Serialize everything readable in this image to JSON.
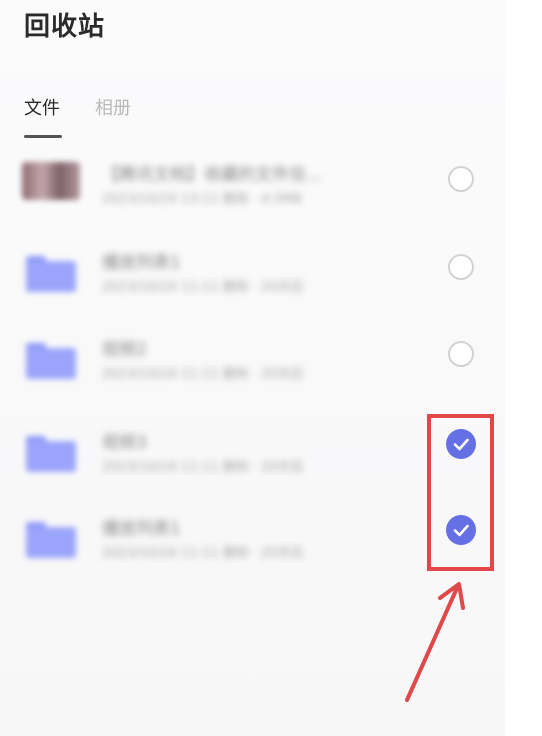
{
  "page": {
    "title": "回收站"
  },
  "tabs": [
    {
      "label": "文件",
      "active": true
    },
    {
      "label": "相册",
      "active": false
    }
  ],
  "items": [
    {
      "icon": "image-thumbnail-icon",
      "name": "【腾讯文档】收藏的文件信...",
      "meta": "2023/10/24 13:11 删除 · 4.5MB",
      "checked": false
    },
    {
      "icon": "folder-icon",
      "name": "播放列表1",
      "meta": "2023/10/24 11:11 删除 · 20天后",
      "checked": false
    },
    {
      "icon": "folder-icon",
      "name": "视频2",
      "meta": "2023/10/24 11:11 删除 · 20天后",
      "checked": false
    },
    {
      "icon": "folder-icon",
      "name": "视频3",
      "meta": "2023/10/24 11:11 删除 · 20天后",
      "checked": true
    },
    {
      "icon": "folder-icon",
      "name": "播放列表1",
      "meta": "2023/10/24 11:11 删除 · 20天后",
      "checked": true
    }
  ],
  "colors": {
    "accent": "#6470e4",
    "folder": "#9aa4fa",
    "annotation": "#e04849"
  }
}
